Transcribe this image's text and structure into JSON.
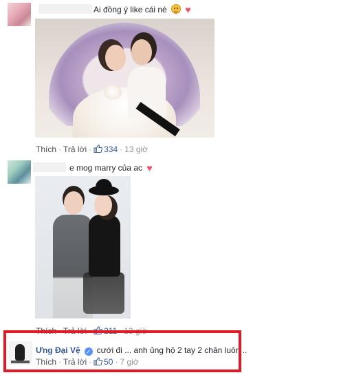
{
  "comments": [
    {
      "text": "Ai đồng ý like cái nè",
      "has_smile_emoji": true,
      "has_heart": true
    },
    {
      "actions": {
        "like_label": "Thích",
        "reply_label": "Trả lời",
        "like_count": "334",
        "time": "13 giờ"
      }
    },
    {
      "text": "e mog marry của ac",
      "has_heart": true
    },
    {
      "actions": {
        "like_label": "Thích",
        "reply_label": "Trả lời",
        "like_count": "211",
        "time": "13 giờ"
      }
    },
    {
      "author": "Ưng Đại Vệ",
      "verified": true,
      "text": "cưới đi ... anh ủng hộ 2 tay 2 chân luôn ..",
      "actions": {
        "like_label": "Thích",
        "reply_label": "Trả lời",
        "like_count": "50",
        "time": "7 giờ"
      }
    }
  ],
  "colors": {
    "link": "#365899",
    "meta": "#90949c",
    "highlight": "#e01b24",
    "heart": "#f25268"
  },
  "icons": {
    "thumb": "thumbs-up-icon",
    "verified": "verified-badge-icon",
    "heart": "heart-icon",
    "smile": "smile-emoji-icon"
  }
}
